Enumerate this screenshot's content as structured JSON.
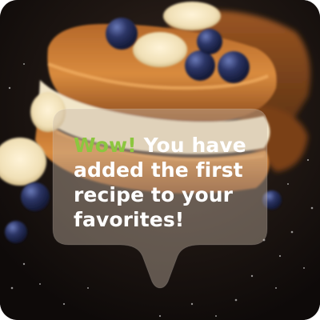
{
  "toast": {
    "highlight": "Wow!",
    "message": " You have added the first recipe to your favorites!"
  },
  "photo": {
    "subject": "french-toast-stack-with-blueberries-and-banana"
  },
  "colors": {
    "accent": "#8cc63f",
    "text": "#ffffff",
    "background": "#120d0b"
  }
}
